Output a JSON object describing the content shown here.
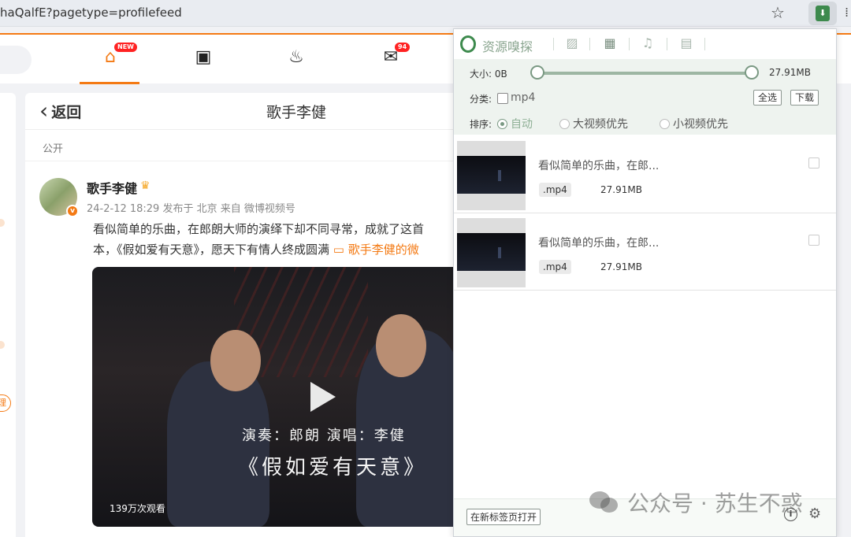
{
  "browser": {
    "url": "haQalfE?pagetype=profilefeed",
    "star_icon": "star-icon",
    "extension_icon": "download-extension-icon"
  },
  "nav": {
    "home_badge": "NEW",
    "messages_badge": "94",
    "accent": "#f47a14"
  },
  "card": {
    "back_label": "返回",
    "title": "歌手李健",
    "visibility": "公开",
    "author": "歌手李健",
    "meta": "24-2-12 18:29  发布于 北京  来自 微博视频号",
    "text_line1": "看似简单的乐曲，在郎朗大师的演绎下却不同寻常，成就了这首",
    "text_line2_plain": "本，《假如爱有天意》，愿天下有情人终成圆满 ",
    "text_line2_link": "歌手李健的微",
    "video_credits": "演奏：郎朗  演唱：李健",
    "video_title": "《假如爱有天意》",
    "video_views": "139万次观看"
  },
  "popup": {
    "title": "资源嗅探",
    "size_label_min": "大小: 0B",
    "size_label_max": "27.91MB",
    "category_label": "分类:",
    "category_value": "mp4",
    "select_all": "全选",
    "download": "下载",
    "sort_label": "排序:",
    "sort_options": [
      "自动",
      "大视频优先",
      "小视频优先"
    ],
    "sort_selected": "自动",
    "items": [
      {
        "title": "看似简单的乐曲，在郎...",
        "format": ".mp4",
        "size": "27.91MB"
      },
      {
        "title": "看似简单的乐曲，在郎...",
        "format": ".mp4",
        "size": "27.91MB"
      }
    ],
    "open_new_tab": "在新标签页打开"
  },
  "watermark": "公众号 · 苏生不惑"
}
